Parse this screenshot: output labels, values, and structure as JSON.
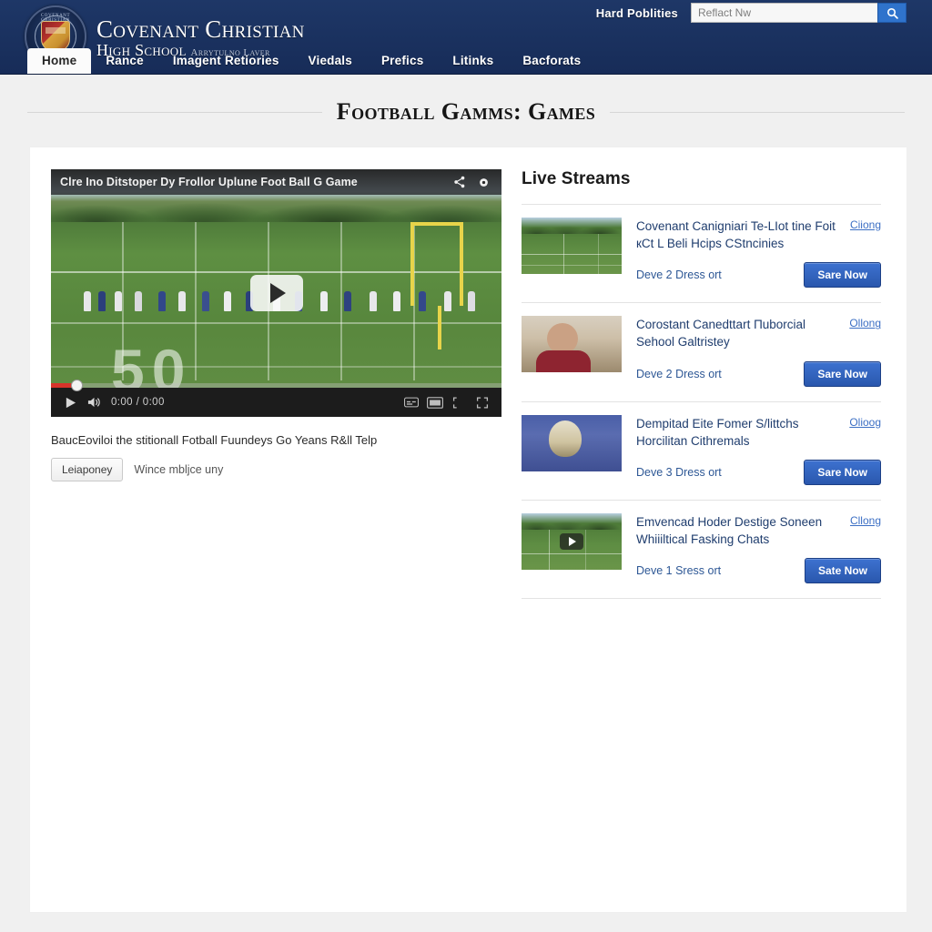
{
  "header": {
    "logo_icon": "school-crest-icon",
    "crest_ring_text": "COVENANT CHRISTIAN",
    "brand_line1": "Covenant Christian",
    "brand_line2": "High School",
    "brand_sub": "Arrytulno Laver",
    "utility_link": "Hard Poblities",
    "search": {
      "placeholder": "Reflact Nw",
      "value": "",
      "icon": "search-icon"
    }
  },
  "nav": {
    "items": [
      {
        "label": "Home",
        "active": true
      },
      {
        "label": "Rance",
        "active": false
      },
      {
        "label": "Imagent Retiories",
        "active": false
      },
      {
        "label": "Viedals",
        "active": false
      },
      {
        "label": "Prefics",
        "active": false
      },
      {
        "label": "Litinks",
        "active": false
      },
      {
        "label": "Bacforats",
        "active": false
      }
    ]
  },
  "page": {
    "title": "Football Gamms: Games"
  },
  "player": {
    "title": "Clre Ino Ditstoper Dy Frollor Uplune Foot Ball G Game",
    "share_icon": "share-icon",
    "settings_icon": "gear-icon",
    "play_icon": "play-icon",
    "big_play_icon": "play-overlay-icon",
    "volume_icon": "volume-icon",
    "time": "0:00 / 0:00",
    "progress_percent": 4,
    "field_number": "50",
    "captions_icon": "captions-icon",
    "theater_icon": "theater-mode-icon",
    "miniplayer_icon": "miniplayer-icon",
    "fullscreen_icon": "fullscreen-icon"
  },
  "caption": {
    "text": "BaucEoviloi the stitionall Fotball Fuundeys Go Yeans R&ll Telp",
    "button_label": "Leiaponey",
    "note": "Wince mbljce uny"
  },
  "streams": {
    "title": "Live Streams",
    "items": [
      {
        "thumb_kind": "field",
        "has_play": false,
        "title": "Covenant Canigniari Te-LIot tine Foit кCt L Beli Hcips CStncinies",
        "tag": "Ciiong",
        "meta": "Deve 2 Dress ort",
        "button_label": "Sare Now"
      },
      {
        "thumb_kind": "portrait",
        "has_play": false,
        "title": "Corostant Canedttart Пuborcial Sehool Galtristey",
        "tag": "Ollong",
        "meta": "Deve 2 Dress ort",
        "button_label": "Sare Now"
      },
      {
        "thumb_kind": "crowd",
        "has_play": false,
        "title": "Dempitad Eite Fomer S/littchs Horcilitan Cithremals",
        "tag": "Olioog",
        "meta": "Deve 3 Dress ort",
        "button_label": "Sare Now"
      },
      {
        "thumb_kind": "field",
        "has_play": true,
        "title": "Emvencad Hoder Destige Soneen Whiiiltical Fasking Chats",
        "tag": "Cllong",
        "meta": "Deve 1 Sress ort",
        "button_label": "Sate Now"
      }
    ]
  },
  "colors": {
    "header_navy": "#1a3160",
    "accent_blue": "#2f73cc",
    "button_blue": "#2a57ad",
    "link_blue": "#1f3d6e",
    "page_bg": "#f0f0f0",
    "card_bg": "#ffffff",
    "progress_red": "#d6342a",
    "goalpost_yellow": "#e8d44a"
  }
}
